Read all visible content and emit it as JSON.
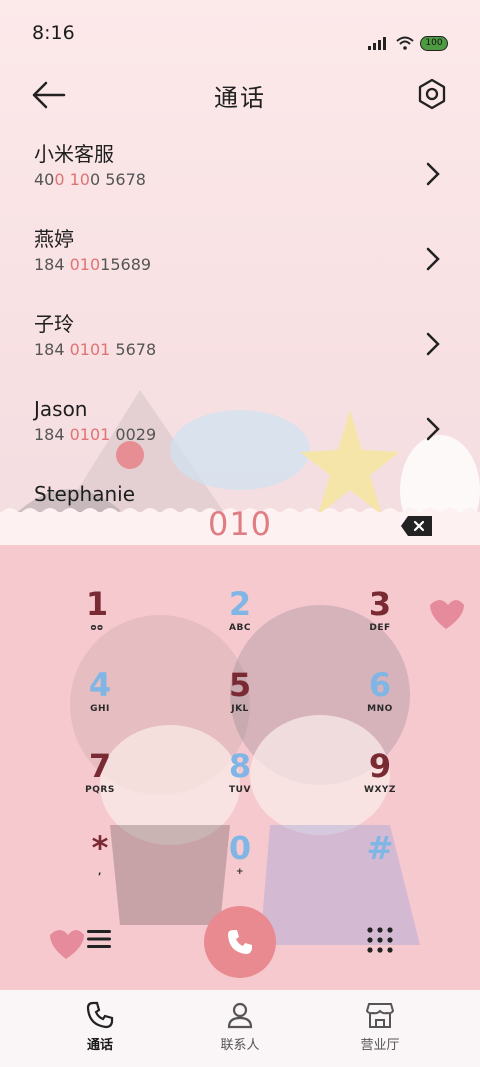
{
  "status": {
    "time": "8:16",
    "battery": "100"
  },
  "header": {
    "title": "通话"
  },
  "list": [
    {
      "name": "小米客服",
      "number_parts": [
        "40",
        "0 10",
        "0 5678"
      ]
    },
    {
      "name": "燕婷",
      "number_parts": [
        "184 ",
        "010",
        "15689"
      ]
    },
    {
      "name": "子玲",
      "number_parts": [
        "184 ",
        "0101",
        " 5678"
      ]
    },
    {
      "name": "Jason",
      "number_parts": [
        "184 ",
        "0101",
        " 0029"
      ]
    },
    {
      "name": "Stephanie",
      "number_parts": [
        "",
        "",
        ""
      ]
    }
  ],
  "dialer": {
    "input": "010",
    "keys": [
      {
        "digit": "1",
        "letters": "ᴑᴑ"
      },
      {
        "digit": "2",
        "letters": "ABC"
      },
      {
        "digit": "3",
        "letters": "DEF"
      },
      {
        "digit": "4",
        "letters": "GHI"
      },
      {
        "digit": "5",
        "letters": "JKL"
      },
      {
        "digit": "6",
        "letters": "MNO"
      },
      {
        "digit": "7",
        "letters": "PQRS"
      },
      {
        "digit": "8",
        "letters": "TUV"
      },
      {
        "digit": "9",
        "letters": "WXYZ"
      },
      {
        "digit": "*",
        "letters": ","
      },
      {
        "digit": "0",
        "letters": "+"
      },
      {
        "digit": "#",
        "letters": ""
      }
    ]
  },
  "nav": {
    "tabs": [
      {
        "label": "通话",
        "icon": "phone-icon"
      },
      {
        "label": "联系人",
        "icon": "person-icon"
      },
      {
        "label": "营业厅",
        "icon": "store-icon"
      }
    ]
  },
  "colors": {
    "accent": "#e07d82",
    "call": "#e88a8f",
    "dialpad_bg": "#f6c9cf"
  }
}
